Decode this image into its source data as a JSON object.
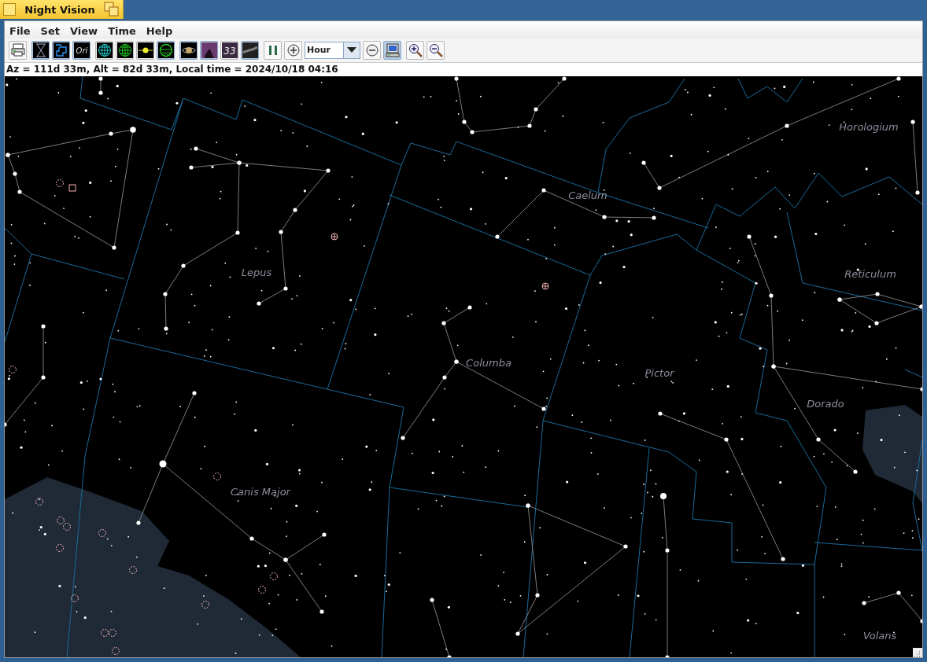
{
  "window": {
    "title": "Night Vision"
  },
  "menu": [
    {
      "label": "File"
    },
    {
      "label": "Set"
    },
    {
      "label": "View"
    },
    {
      "label": "Time"
    },
    {
      "label": "Help"
    }
  ],
  "toolbar": [
    [
      {
        "kind": "print",
        "selected": false
      }
    ],
    [
      {
        "kind": "lines",
        "selected": true
      },
      {
        "kind": "boundaries",
        "selected": true
      },
      {
        "kind": "names",
        "label": "Ori",
        "selected": true
      }
    ],
    [
      {
        "kind": "equatorial",
        "selected": false
      },
      {
        "kind": "altaz",
        "selected": false
      },
      {
        "kind": "ecliptic",
        "selected": false
      },
      {
        "kind": "horizon",
        "selected": true
      }
    ],
    [
      {
        "kind": "planets",
        "selected": true
      },
      {
        "kind": "nebulae",
        "selected": true
      },
      {
        "kind": "messier",
        "label": "33",
        "selected": false
      },
      {
        "kind": "milkyway",
        "selected": true
      }
    ],
    [
      {
        "kind": "pause",
        "selected": false
      },
      {
        "kind": "plus",
        "selected": false
      },
      {
        "kind": "step",
        "value": "Hour"
      },
      {
        "kind": "minus",
        "selected": false
      },
      {
        "kind": "computer",
        "selected": true
      }
    ],
    [
      {
        "kind": "zoomin",
        "selected": false
      },
      {
        "kind": "zoomout",
        "selected": false
      }
    ]
  ],
  "status": "Az = 111d 33m, Alt = 82d 33m, Local time = 2024/10/18 04:16",
  "constellations": [
    {
      "name": "Horologium"
    },
    {
      "name": "Caelum"
    },
    {
      "name": "Lepus"
    },
    {
      "name": "Reticulum"
    },
    {
      "name": "Columba"
    },
    {
      "name": "Pictor"
    },
    {
      "name": "Dorado"
    },
    {
      "name": "Canis Major"
    },
    {
      "name": "Volans"
    }
  ]
}
